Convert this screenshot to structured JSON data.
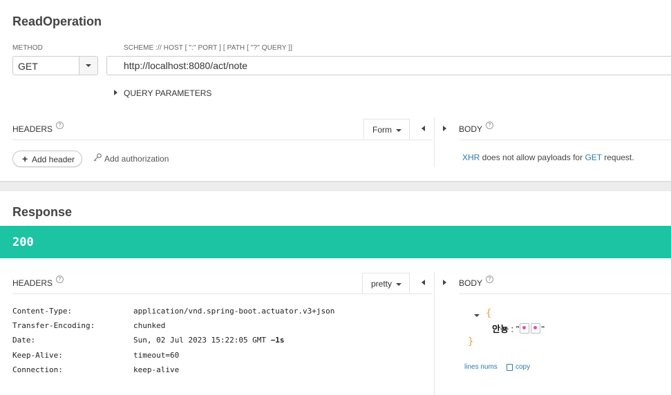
{
  "request": {
    "title": "ReadOperation",
    "method_label": "METHOD",
    "url_label": "SCHEME :// HOST [ \":\" PORT ] [ PATH [ \"?\" QUERY ]]",
    "method": "GET",
    "url": "http://localhost:8080/act/note",
    "query_params_label": "QUERY PARAMETERS",
    "headers_label": "HEADERS",
    "headers_mode": "Form",
    "body_label": "BODY",
    "add_header_label": "Add header",
    "add_authorization_label": "Add authorization",
    "body_message": {
      "xhr": "XHR",
      "middle": " does not allow payloads for ",
      "method": "GET",
      "end": " request."
    }
  },
  "response": {
    "title": "Response",
    "status_code": "200",
    "status_color": "#1cc4a4",
    "headers_label": "HEADERS",
    "headers_mode": "pretty",
    "body_label": "BODY",
    "headers": [
      {
        "key": "Content-Type:",
        "value": "application/vnd.spring-boot.actuator.v3+json",
        "extra": ""
      },
      {
        "key": "Transfer-Encoding:",
        "value": "chunked",
        "extra": ""
      },
      {
        "key": "Date:",
        "value": "Sun, 02 Jul 2023 15:22:05 GMT ",
        "extra": "−1s"
      },
      {
        "key": "Keep-Alive:",
        "value": "timeout=60",
        "extra": ""
      },
      {
        "key": "Connection:",
        "value": "keep-alive",
        "extra": ""
      }
    ],
    "body_json": {
      "open_brace": "{",
      "key": "안뇽",
      "separator": " :  ",
      "quote": "\"",
      "close_brace": "}"
    },
    "lines_nums_label": "lines nums",
    "copy_label": "copy"
  }
}
